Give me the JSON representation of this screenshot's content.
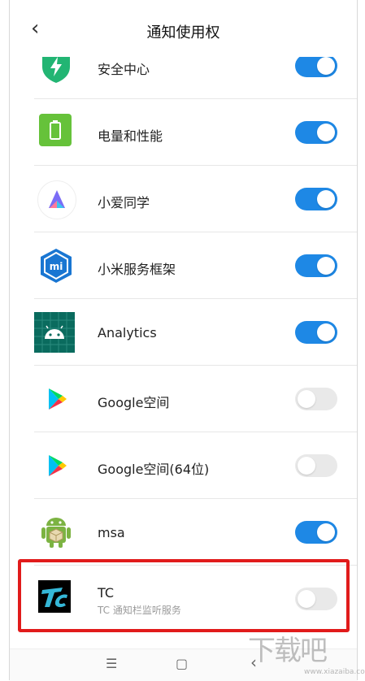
{
  "header": {
    "title": "通知使用权",
    "back_icon": "‹"
  },
  "apps": [
    {
      "name": "安全中心",
      "subtitle": "",
      "enabled": true,
      "icon": "shield-icon"
    },
    {
      "name": "电量和性能",
      "subtitle": "",
      "enabled": true,
      "icon": "battery-icon"
    },
    {
      "name": "小爱同学",
      "subtitle": "",
      "enabled": true,
      "icon": "xiaoai-icon"
    },
    {
      "name": "小米服务框架",
      "subtitle": "",
      "enabled": true,
      "icon": "mi-service-icon"
    },
    {
      "name": "Analytics",
      "subtitle": "",
      "enabled": true,
      "icon": "android-icon"
    },
    {
      "name": "Google空间",
      "subtitle": "",
      "enabled": false,
      "icon": "play-icon"
    },
    {
      "name": "Google空间(64位)",
      "subtitle": "",
      "enabled": false,
      "icon": "play-icon"
    },
    {
      "name": "msa",
      "subtitle": "",
      "enabled": true,
      "icon": "android-robot-icon"
    },
    {
      "name": "TC",
      "subtitle": "TC 通知栏监听服务",
      "enabled": false,
      "icon": "tc-icon"
    }
  ],
  "navbar": {
    "menu": "☰",
    "home": "▢",
    "back": "‹"
  },
  "watermark": {
    "text": "下载吧",
    "url": "www.xiazaiba.com"
  },
  "colors": {
    "toggle_on": "#1e88e5",
    "toggle_off": "#e9e9e9",
    "highlight": "#e11b1b"
  }
}
